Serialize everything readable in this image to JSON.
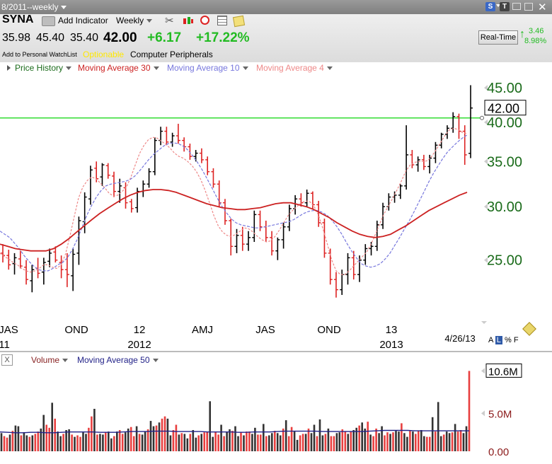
{
  "toolbar": {
    "period": "8/2011--weekly",
    "symbol": "SYNA",
    "add_indicator": "Add Indicator",
    "interval": "Weekly",
    "quote_open": "35.98",
    "quote_high": "45.40",
    "quote_low": "35.40",
    "quote_last": "42.00",
    "quote_change": "+6.17",
    "quote_pct": "+17.22%",
    "watchlist": "Add to Personal WatchList",
    "optionable": "Optionable",
    "industry": "Computer Peripherals",
    "realtime": "Real-Time",
    "rt_change": "3.46",
    "rt_pct": "8.98%",
    "badge_s": "S",
    "badge_t": "T"
  },
  "legend": {
    "price_history": "Price History",
    "ma30": "Moving Average 30",
    "ma10": "Moving Average 10",
    "ma4": "Moving Average 4"
  },
  "volume_legend": {
    "close": "X",
    "volume": "Volume",
    "ma50": "Moving Average 50"
  },
  "scale_options": [
    "A",
    "L",
    "%",
    "F"
  ],
  "colors": {
    "up_bar": "#000000",
    "down_bar": "#dd2222",
    "ma30": "#cc2222",
    "ma10": "#7777dd",
    "ma4": "#ee8888",
    "resistance": "#33dd33",
    "axis_text": "#1a6b1a",
    "volume_up": "#333333",
    "volume_down": "#e84040",
    "volume_ma": "#222288"
  },
  "chart_data": [
    {
      "type": "ohlc",
      "last_price_label": "42.00",
      "horizontal_line": 40.6,
      "y_ticks": [
        25.0,
        30.0,
        35.0,
        40.0,
        45.0
      ],
      "y_tick_labels": [
        "25.00",
        "30.00",
        "35.00",
        "40.00",
        "45.00"
      ],
      "ylim": [
        21.0,
        46.0
      ],
      "log_scale": true,
      "x_labels": [
        "JAS",
        "OND",
        "12",
        "AMJ",
        "JAS",
        "OND",
        "13"
      ],
      "x_year_labels": [
        "11",
        "2012",
        "2013"
      ],
      "date_label": "4/26/13",
      "bars": [
        [
          25.6,
          26.4,
          24.8,
          25.4
        ],
        [
          25.4,
          25.9,
          24.2,
          24.6
        ],
        [
          24.7,
          25.6,
          23.8,
          25.2
        ],
        [
          25.1,
          25.8,
          24.3,
          24.5
        ],
        [
          24.4,
          25.0,
          23.0,
          23.4
        ],
        [
          23.3,
          24.6,
          22.4,
          24.2
        ],
        [
          24.3,
          25.2,
          23.5,
          23.9
        ],
        [
          24.0,
          25.2,
          23.0,
          24.8
        ],
        [
          24.9,
          26.0,
          24.4,
          25.6
        ],
        [
          25.7,
          26.2,
          24.8,
          25.0
        ],
        [
          24.8,
          25.4,
          23.5,
          24.2
        ],
        [
          24.2,
          25.6,
          22.8,
          23.8
        ],
        [
          23.7,
          26.0,
          22.5,
          25.5
        ],
        [
          25.6,
          29.0,
          24.6,
          28.6
        ],
        [
          28.5,
          31.5,
          27.4,
          31.0
        ],
        [
          30.8,
          34.5,
          30.2,
          34.0
        ],
        [
          34.2,
          35.0,
          32.6,
          33.0
        ],
        [
          33.2,
          34.8,
          32.2,
          34.6
        ],
        [
          34.5,
          34.8,
          33.0,
          33.4
        ],
        [
          33.3,
          33.8,
          31.0,
          31.6
        ],
        [
          31.6,
          33.0,
          30.4,
          32.2
        ],
        [
          32.0,
          32.6,
          29.8,
          30.4
        ],
        [
          30.5,
          30.8,
          29.4,
          29.8
        ],
        [
          29.9,
          32.0,
          29.4,
          31.6
        ],
        [
          31.6,
          32.8,
          31.0,
          32.4
        ],
        [
          32.4,
          34.2,
          32.0,
          33.8
        ],
        [
          33.8,
          38.0,
          33.4,
          37.6
        ],
        [
          37.6,
          39.4,
          37.0,
          38.8
        ],
        [
          38.8,
          39.4,
          37.0,
          37.4
        ],
        [
          37.4,
          38.6,
          36.8,
          38.2
        ],
        [
          38.2,
          39.8,
          37.2,
          37.6
        ],
        [
          37.6,
          38.0,
          36.2,
          36.8
        ],
        [
          36.8,
          37.2,
          35.2,
          35.6
        ],
        [
          35.6,
          36.4,
          35.0,
          36.0
        ],
        [
          36.0,
          36.6,
          34.8,
          35.2
        ],
        [
          35.2,
          35.6,
          33.4,
          33.8
        ],
        [
          33.8,
          34.2,
          32.0,
          32.4
        ],
        [
          32.4,
          32.8,
          30.0,
          30.4
        ],
        [
          30.4,
          30.8,
          28.2,
          28.6
        ],
        [
          28.6,
          28.8,
          25.4,
          26.2
        ],
        [
          26.2,
          27.8,
          25.6,
          27.2
        ],
        [
          27.2,
          28.0,
          25.8,
          26.4
        ],
        [
          26.4,
          27.6,
          25.8,
          27.0
        ],
        [
          27.0,
          29.6,
          26.6,
          29.2
        ],
        [
          29.2,
          29.6,
          27.6,
          28.0
        ],
        [
          28.0,
          28.6,
          26.6,
          27.0
        ],
        [
          27.0,
          27.6,
          25.4,
          25.8
        ],
        [
          25.8,
          27.0,
          25.0,
          26.8
        ],
        [
          26.8,
          28.4,
          26.0,
          28.0
        ],
        [
          28.0,
          30.2,
          27.6,
          29.8
        ],
        [
          29.8,
          31.2,
          29.2,
          30.8
        ],
        [
          30.8,
          31.4,
          30.0,
          30.4
        ],
        [
          30.4,
          31.8,
          30.0,
          31.4
        ],
        [
          31.4,
          31.6,
          29.8,
          30.2
        ],
        [
          30.2,
          30.6,
          28.0,
          28.4
        ],
        [
          28.4,
          28.8,
          25.2,
          25.6
        ],
        [
          25.6,
          26.0,
          23.0,
          23.4
        ],
        [
          23.4,
          24.0,
          22.0,
          22.6
        ],
        [
          22.6,
          24.2,
          22.2,
          23.8
        ],
        [
          23.8,
          25.6,
          23.0,
          25.2
        ],
        [
          25.2,
          25.8,
          23.4,
          23.8
        ],
        [
          23.8,
          25.4,
          23.2,
          25.0
        ],
        [
          25.0,
          26.4,
          24.6,
          26.0
        ],
        [
          26.0,
          26.6,
          25.4,
          26.2
        ],
        [
          26.2,
          28.6,
          25.8,
          28.2
        ],
        [
          28.2,
          30.4,
          27.8,
          30.0
        ],
        [
          30.0,
          31.4,
          29.6,
          31.0
        ],
        [
          31.0,
          31.6,
          30.4,
          31.2
        ],
        [
          31.2,
          32.4,
          30.8,
          32.2
        ],
        [
          32.2,
          39.6,
          31.8,
          35.8
        ],
        [
          35.8,
          36.4,
          34.2,
          34.6
        ],
        [
          34.6,
          35.6,
          33.8,
          35.2
        ],
        [
          35.2,
          35.8,
          34.0,
          34.4
        ],
        [
          34.4,
          35.8,
          33.6,
          35.4
        ],
        [
          35.4,
          37.4,
          34.8,
          37.0
        ],
        [
          37.0,
          38.6,
          36.6,
          38.4
        ],
        [
          38.4,
          39.6,
          37.8,
          39.2
        ],
        [
          39.2,
          41.4,
          38.6,
          40.8
        ],
        [
          40.8,
          41.2,
          37.8,
          38.8
        ],
        [
          38.8,
          39.6,
          34.6,
          35.8
        ],
        [
          35.98,
          45.4,
          35.4,
          42.0
        ]
      ],
      "ma30": [
        26.4,
        26.2,
        26.0,
        25.9,
        25.8,
        25.8,
        25.8,
        26.0,
        26.4,
        26.9,
        27.5,
        28.1,
        28.7,
        29.3,
        29.8,
        30.3,
        30.8,
        31.2,
        31.5,
        31.7,
        31.8,
        31.8,
        31.7,
        31.5,
        31.2,
        30.9,
        30.6,
        30.3,
        30.1,
        29.9,
        29.8,
        29.7,
        29.7,
        29.8,
        29.9,
        30.1,
        30.3,
        30.4,
        30.4,
        30.2,
        30.0,
        29.7,
        29.3,
        28.9,
        28.4,
        28.0,
        27.6,
        27.3,
        27.1,
        27.0,
        27.1,
        27.3,
        27.7,
        28.1,
        28.6,
        29.1,
        29.6,
        30.0,
        30.4,
        30.8,
        31.2,
        31.5
      ],
      "ma10": [
        27.6,
        27.3,
        27.0,
        26.5,
        26.0,
        25.4,
        24.9,
        24.5,
        24.2,
        24.1,
        24.1,
        24.3,
        24.6,
        24.8,
        25.2,
        25.9,
        26.8,
        27.9,
        29.1,
        30.1,
        31.0,
        31.7,
        32.2,
        32.4,
        32.5,
        32.6,
        32.7,
        32.9,
        33.3,
        33.9,
        34.6,
        35.3,
        35.9,
        36.4,
        36.9,
        37.2,
        37.3,
        37.2,
        36.9,
        36.4,
        35.7,
        34.9,
        34.0,
        33.0,
        32.0,
        31.0,
        30.1,
        29.4,
        28.8,
        28.4,
        28.2,
        28.1,
        28.0,
        27.9,
        27.9,
        28.0,
        28.1,
        28.2,
        28.3,
        28.4,
        28.5,
        28.7,
        29.0,
        29.3,
        29.5,
        29.6,
        29.6,
        29.4,
        29.1,
        28.6,
        28.0,
        27.3,
        26.5,
        25.8,
        25.2,
        24.7,
        24.5,
        24.4,
        24.5,
        24.7,
        25.1,
        25.6,
        26.3,
        27.0,
        27.8,
        28.6,
        29.5,
        30.5,
        31.5,
        32.6,
        33.6,
        34.5,
        35.4,
        36.2,
        36.8,
        37.4,
        37.9,
        38.3
      ],
      "ma4": [
        25.6,
        25.3,
        25.1,
        24.8,
        24.6,
        24.3,
        24.1,
        24.0,
        24.1,
        24.3,
        24.6,
        24.6,
        24.4,
        24.3,
        24.6,
        25.5,
        27.1,
        29.0,
        30.9,
        32.1,
        32.8,
        33.2,
        33.0,
        32.5,
        32.0,
        31.4,
        31.1,
        31.2,
        31.6,
        32.1,
        33.2,
        34.6,
        36.0,
        37.0,
        37.7,
        38.0,
        37.9,
        37.5,
        37.1,
        36.6,
        36.0,
        35.6,
        35.4,
        35.0,
        34.5,
        33.8,
        32.9,
        31.7,
        30.4,
        29.1,
        28.1,
        27.5,
        27.2,
        27.1,
        27.3,
        27.6,
        27.9,
        27.8,
        27.5,
        27.1,
        26.8,
        26.6,
        26.7,
        27.1,
        27.7,
        28.4,
        29.1,
        29.6,
        30.0,
        30.4,
        30.6,
        30.5,
        30.0,
        29.1,
        27.8,
        26.4,
        25.0,
        24.1,
        23.8,
        23.8,
        24.1,
        24.5,
        24.9,
        25.3,
        25.7,
        26.4,
        27.3,
        28.3,
        29.3,
        30.1,
        30.9,
        31.8,
        32.8,
        33.9,
        34.6,
        34.9,
        35.0,
        35.0,
        35.1,
        35.7,
        36.5,
        37.4,
        38.3,
        39.0,
        39.2,
        39.0,
        38.6,
        38.5
      ]
    },
    {
      "type": "bar",
      "title": "Volume",
      "y_tick_labels": [
        "10.6M",
        "5.0M",
        "0.00"
      ],
      "last_volume_label": "10.6M",
      "ylim": [
        0,
        11.2
      ],
      "values": [
        2.4,
        2.0,
        1.8,
        2.2,
        2.7,
        3.4,
        3.3,
        2.1,
        2.5,
        2.1,
        1.9,
        2.1,
        2.3,
        2.6,
        3.0,
        4.8,
        3.5,
        3.1,
        6.4,
        4.3,
        2.6,
        2.0,
        2.3,
        2.8,
        2.9,
        2.2,
        1.9,
        2.1,
        1.9,
        2.5,
        2.3,
        3.1,
        4.6,
        5.6,
        2.2,
        2.3,
        2.2,
        2.5,
        2.6,
        1.7,
        2.0,
        2.6,
        2.8,
        2.3,
        2.5,
        3.0,
        3.2,
        2.0,
        3.3,
        2.3,
        2.2,
        2.6,
        2.9,
        4.0,
        3.3,
        3.4,
        3.8,
        4.3,
        4.6,
        4.3,
        2.1,
        2.8,
        3.5,
        2.2,
        2.4,
        2.3,
        1.7,
        2.3,
        2.8,
        1.8,
        2.1,
        2.3,
        2.5,
        2.6,
        6.6,
        1.9,
        2.6,
        2.2,
        3.5,
        2.0,
        2.6,
        2.9,
        2.7,
        3.3,
        2.0,
        2.5,
        2.1,
        2.6,
        2.6,
        2.3,
        3.1,
        2.2,
        2.2,
        3.6,
        2.0,
        2.1,
        2.4,
        2.7,
        2.4,
        2.1,
        3.0,
        4.1,
        2.0,
        3.2,
        2.6,
        1.5,
        2.1,
        2.3,
        2.3,
        3.0,
        2.4,
        3.5,
        2.0,
        4.2,
        2.1,
        2.3,
        3.0,
        2.0,
        2.0,
        2.4,
        2.5,
        2.9,
        2.6,
        2.3,
        2.6,
        2.8,
        3.1,
        3.4,
        3.8,
        3.0,
        3.9,
        2.2,
        2.0,
        3.0,
        2.4,
        3.3,
        2.1,
        2.5,
        2.3,
        2.5,
        2.7,
        2.6,
        3.7,
        2.4,
        1.9,
        2.7,
        2.6,
        2.3,
        2.7,
        2.8,
        2.0,
        1.9,
        1.9,
        4.5,
        2.6,
        6.5,
        2.0,
        2.2,
        2.6,
        2.4,
        2.5,
        3.6,
        2.6,
        2.8,
        2.4,
        3.3,
        10.6
      ],
      "ma50": [
        2.55,
        2.5,
        2.45,
        2.45,
        2.5,
        2.5,
        2.45,
        2.45,
        2.5,
        2.55,
        2.55,
        2.55,
        2.55,
        2.5,
        2.5,
        2.5,
        2.55,
        2.6,
        2.6,
        2.6,
        2.65,
        2.65,
        2.65,
        2.6,
        2.6,
        2.6,
        2.6,
        2.55,
        2.55,
        2.55,
        2.55,
        2.5,
        2.5,
        2.55,
        2.55,
        2.55,
        2.6,
        2.65,
        2.65,
        2.65,
        2.65,
        2.65,
        2.6,
        2.6,
        2.6,
        2.6,
        2.6,
        2.6,
        2.65,
        2.7,
        2.75,
        2.75,
        2.75,
        2.75,
        2.7,
        2.7,
        2.7,
        2.7,
        2.7,
        2.7,
        2.7,
        2.7
      ]
    }
  ]
}
